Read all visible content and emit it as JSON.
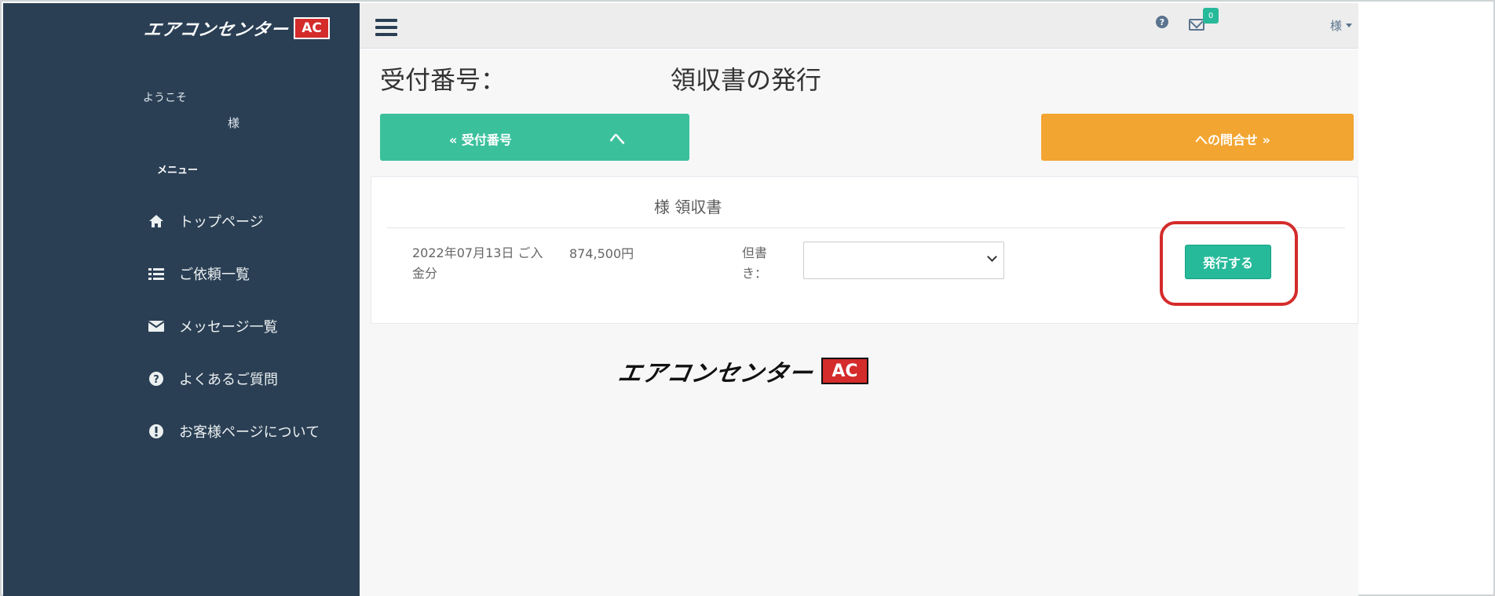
{
  "sidebar": {
    "brand_text": "エアコンセンター",
    "brand_mark": "AC",
    "welcome": "ようこそ",
    "user_suffix": "様",
    "menu_title": "メニュー",
    "items": [
      {
        "label": "トップページ",
        "icon": "home-icon"
      },
      {
        "label": "ご依頼一覧",
        "icon": "list-icon"
      },
      {
        "label": "メッセージ一覧",
        "icon": "envelope-icon"
      },
      {
        "label": "よくあるご質問",
        "icon": "question-circle-icon"
      },
      {
        "label": "お客様ページについて",
        "icon": "exclamation-circle-icon"
      }
    ]
  },
  "topbar": {
    "help_glyph": "?",
    "mail_badge": "0",
    "user_label": "様"
  },
  "main": {
    "title_left": "受付番号：",
    "title_right": "領収書の発行",
    "back_button": "« 受付番号",
    "back_button_suffix": "へ",
    "contact_button": "への問合せ »",
    "panel": {
      "title": "様 領収書",
      "row": {
        "date_line": "2022年07月13日 ご入金分",
        "amount": "874,500円",
        "note_label": "但書き：",
        "note_value": "",
        "issue_button": "発行する"
      }
    },
    "footer_brand_text": "エアコンセンター",
    "footer_brand_mark": "AC"
  },
  "colors": {
    "sidebar_bg": "#2a3f54",
    "green": "#3bc09c",
    "orange": "#f2a531",
    "highlight": "#d42b2b"
  }
}
